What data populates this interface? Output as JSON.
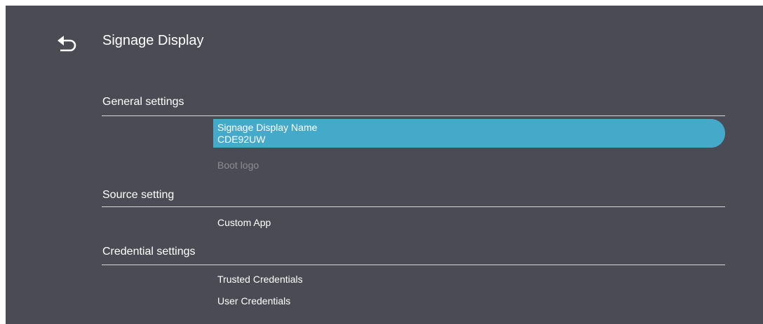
{
  "header": {
    "back_icon": "back-arrow-icon",
    "title": "Signage Display"
  },
  "sections": [
    {
      "title": "General settings",
      "items": [
        {
          "label": "Signage Display Name",
          "value": "CDE92UW",
          "selected": true
        },
        {
          "label": "Boot logo",
          "disabled": true
        }
      ]
    },
    {
      "title": "Source setting",
      "items": [
        {
          "label": "Custom App"
        }
      ]
    },
    {
      "title": "Credential settings",
      "items": [
        {
          "label": "Trusted Credentials"
        },
        {
          "label": "User Credentials"
        }
      ]
    }
  ],
  "colors": {
    "background": "#4b4b55",
    "selection": "#45a9c9",
    "text": "#ffffff",
    "disabled_text": "#8d8d95",
    "divider": "#d8d8dc"
  }
}
